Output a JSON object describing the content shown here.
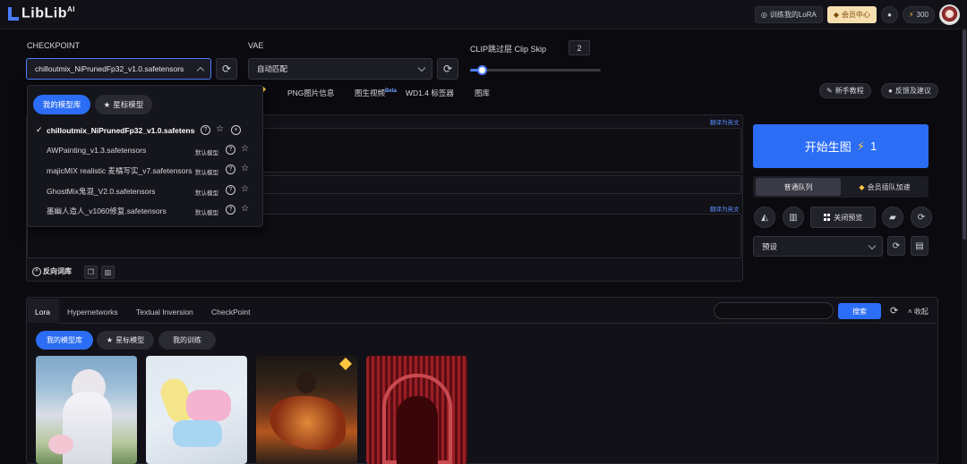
{
  "header": {
    "logo": "LibLib",
    "logo_sup": "AI",
    "train_lora": "训练我的LoRA",
    "vip_center": "会员中心",
    "points": "300"
  },
  "checkpoint": {
    "label": "CHECKPOINT",
    "value": "chilloutmix_NiPrunedFp32_v1.0.safetensors"
  },
  "vae": {
    "label": "VAE",
    "value": "自动匹配"
  },
  "clip": {
    "label": "CLIP跳过层 Clip Skip",
    "value": "2",
    "slider_fraction": 0.09
  },
  "tabs": [
    "PNG图片信息",
    "图生视频",
    "WD1.4 标签器",
    "图库"
  ],
  "beta": "Beta",
  "help": {
    "tutorial": "新手教程",
    "feedback": "反馈及建议"
  },
  "prompt": {
    "translate_1": "翻译为英文",
    "translate_2": "翻译为英文",
    "negative_lib": "反向词库"
  },
  "generate": {
    "label": "开始生图",
    "cost": "1"
  },
  "queue": {
    "normal": "普通队列",
    "vip": "会员插队加速"
  },
  "close_preview": "关闭预览",
  "preset": "预设",
  "dropdown": {
    "tab_my": "我的模型库",
    "tab_star": "星标模型",
    "items": [
      {
        "name": "chilloutmix_NiPrunedFp32_v1.0.safetensors",
        "tag": ""
      },
      {
        "name": "AWPainting_v1.3.safetensors",
        "tag": "默认模型"
      },
      {
        "name": "majicMIX realistic 麦橘写实_v7.safetensors",
        "tag": "默认模型"
      },
      {
        "name": "GhostMix鬼混_V2.0.safetensors",
        "tag": "默认模型"
      },
      {
        "name": "墨幽人造人_v1060修复.safetensors",
        "tag": "默认模型"
      }
    ]
  },
  "lower": {
    "tabs": [
      "Lora",
      "Hypernetworks",
      "Textual Inversion",
      "CheckPoint"
    ],
    "search_placeholder": "",
    "search_btn": "搜索",
    "collapse": "收起",
    "pill_my": "我的模型库",
    "pill_star": "星标模型",
    "pill_train": "我的训练"
  },
  "colors": {
    "accent": "#2b6df5",
    "vip_bg": "#f7dfb0",
    "bolt": "#ffc53d"
  }
}
